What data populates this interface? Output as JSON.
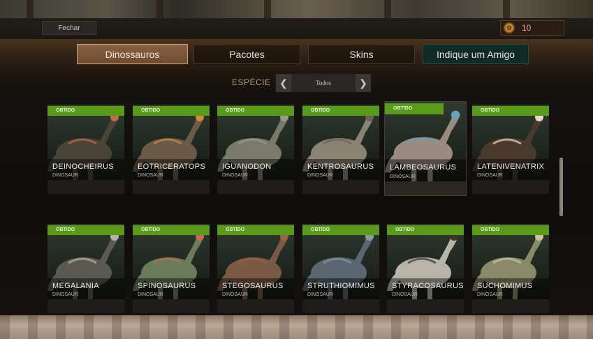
{
  "header": {
    "close_label": "Fechar",
    "coins": {
      "icon": "paw-coin-icon",
      "value": "10"
    }
  },
  "tabs": [
    {
      "label": "Dinossauros",
      "active": true
    },
    {
      "label": "Pacotes",
      "active": false
    },
    {
      "label": "Skins",
      "active": false
    },
    {
      "label": "Indique um Amigo",
      "active": false
    }
  ],
  "filter": {
    "label": "ESPÉCIE",
    "value": "Todos",
    "prev_icon": "chevron-left-icon",
    "next_icon": "chevron-right-icon"
  },
  "cards": [
    {
      "badge": "OBTIDO",
      "name": "DEINOCHEIRUS",
      "type": "DINOSAUR",
      "color": "#4a4438",
      "accent": "#c26a4a"
    },
    {
      "badge": "OBTIDO",
      "name": "EOTRICERATOPS",
      "type": "DINOSAUR",
      "color": "#6a5a48",
      "accent": "#d08a3a"
    },
    {
      "badge": "OBTIDO",
      "name": "IGUANODON",
      "type": "DINOSAUR",
      "color": "#7a7a6a",
      "accent": "#9a9a88"
    },
    {
      "badge": "OBTIDO",
      "name": "KENTROSAURUS",
      "type": "DINOSAUR",
      "color": "#8a8272",
      "accent": "#6a6252"
    },
    {
      "badge": "OBTIDO",
      "name": "LAMBEOSAURUS",
      "type": "DINOSAUR",
      "color": "#9a8a80",
      "accent": "#6aa0b8",
      "selected": true
    },
    {
      "badge": "OBTIDO",
      "name": "LATENIVENATRIX",
      "type": "DINOSAUR",
      "color": "#4a3a2e",
      "accent": "#e8d8c0"
    },
    {
      "badge": "OBTIDO",
      "name": "MEGALANIA",
      "type": "DINOSAUR",
      "color": "#5a5a50",
      "accent": "#bab4a4"
    },
    {
      "badge": "OBTIDO",
      "name": "SPINOSAURUS",
      "type": "DINOSAUR",
      "color": "#6a7a5a",
      "accent": "#c86a52"
    },
    {
      "badge": "OBTIDO",
      "name": "STEGOSAURUS",
      "type": "DINOSAUR",
      "color": "#7a5a44",
      "accent": "#a06040"
    },
    {
      "badge": "OBTIDO",
      "name": "STRUTHIOMIMUS",
      "type": "DINOSAUR",
      "color": "#5a6670",
      "accent": "#8a96a0"
    },
    {
      "badge": "OBTIDO",
      "name": "STYRACOSAURUS",
      "type": "DINOSAUR",
      "color": "#b8b4aa",
      "accent": "#3a3630"
    },
    {
      "badge": "OBTIDO",
      "name": "SUCHOMIMUS",
      "type": "DINOSAUR",
      "color": "#8a8a6a",
      "accent": "#c8c4a0"
    }
  ]
}
